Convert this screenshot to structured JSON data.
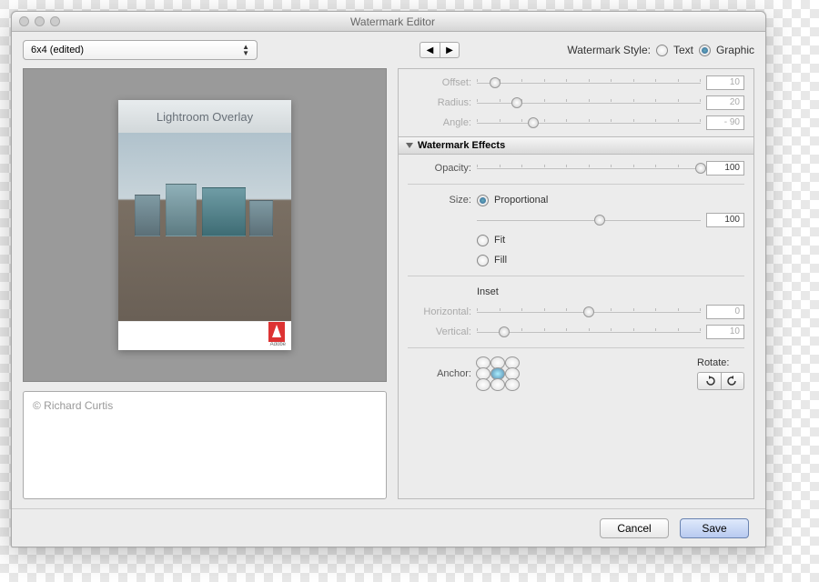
{
  "window_title": "Watermark Editor",
  "preset": {
    "selected": "6x4 (edited)"
  },
  "watermark_style": {
    "label": "Watermark Style:",
    "options": {
      "text": "Text",
      "graphic": "Graphic"
    },
    "selected": "graphic"
  },
  "preview": {
    "overlay_text": "Lightroom Overlay",
    "brand": "Adobe"
  },
  "copyright_text": "© Richard Curtis",
  "shadow": {
    "offset": {
      "label": "Offset:",
      "value": "10"
    },
    "radius": {
      "label": "Radius:",
      "value": "20"
    },
    "angle": {
      "label": "Angle:",
      "value": "- 90"
    }
  },
  "effects": {
    "header": "Watermark Effects",
    "opacity": {
      "label": "Opacity:",
      "value": "100"
    },
    "size": {
      "label": "Size:",
      "option_proportional": "Proportional",
      "option_fit": "Fit",
      "option_fill": "Fill",
      "value": "100"
    },
    "inset": {
      "label": "Inset",
      "horizontal": {
        "label": "Horizontal:",
        "value": "0"
      },
      "vertical": {
        "label": "Vertical:",
        "value": "10"
      }
    },
    "anchor_label": "Anchor:",
    "rotate_label": "Rotate:"
  },
  "buttons": {
    "cancel": "Cancel",
    "save": "Save"
  }
}
